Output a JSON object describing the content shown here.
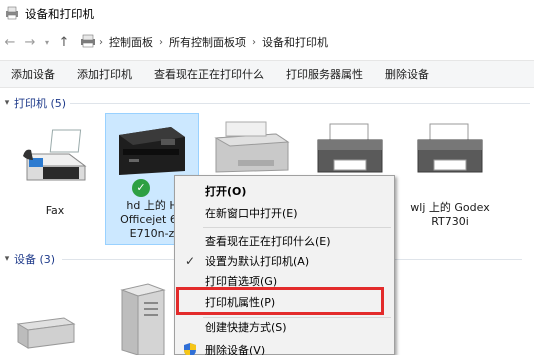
{
  "window": {
    "title": "设备和打印机"
  },
  "address": {
    "crumbs": [
      "控制面板",
      "所有控制面板项",
      "设备和打印机"
    ]
  },
  "toolbar": {
    "buttons": [
      "添加设备",
      "添加打印机",
      "查看现在正在打印什么",
      "打印服务器属性",
      "删除设备"
    ]
  },
  "groups": {
    "printers": {
      "label": "打印机 (5)"
    },
    "devices": {
      "label": "设备 (3)"
    }
  },
  "printers": [
    {
      "name": "Fax",
      "icon": "fax-icon"
    },
    {
      "name_lines": [
        "hd 上的 H",
        "Officejet 65",
        "E710n-z"
      ],
      "icon": "printer-icon",
      "default": true
    },
    {
      "name": "",
      "icon": "printer-icon"
    },
    {
      "name": "",
      "icon": "printer-icon"
    },
    {
      "name_lines": [
        "wlj 上的 Godex",
        "RT730i"
      ],
      "icon": "printer-icon"
    }
  ],
  "context_menu": {
    "items": [
      {
        "label": "打开(O)",
        "bold": true
      },
      {
        "label": "在新窗口中打开(E)"
      },
      {
        "label": "查看现在正在打印什么(E)"
      },
      {
        "label": "设置为默认打印机(A)",
        "checked": true
      },
      {
        "label": "打印首选项(G)"
      },
      {
        "label": "打印机属性(P)",
        "highlighted": true
      },
      {
        "label": "创建快捷方式(S)"
      },
      {
        "label": "删除设备(V)",
        "shield": true
      }
    ]
  },
  "colors": {
    "accent": "#1e3a8a",
    "selection": "#cce8ff",
    "highlight_border": "#e32b2b"
  }
}
